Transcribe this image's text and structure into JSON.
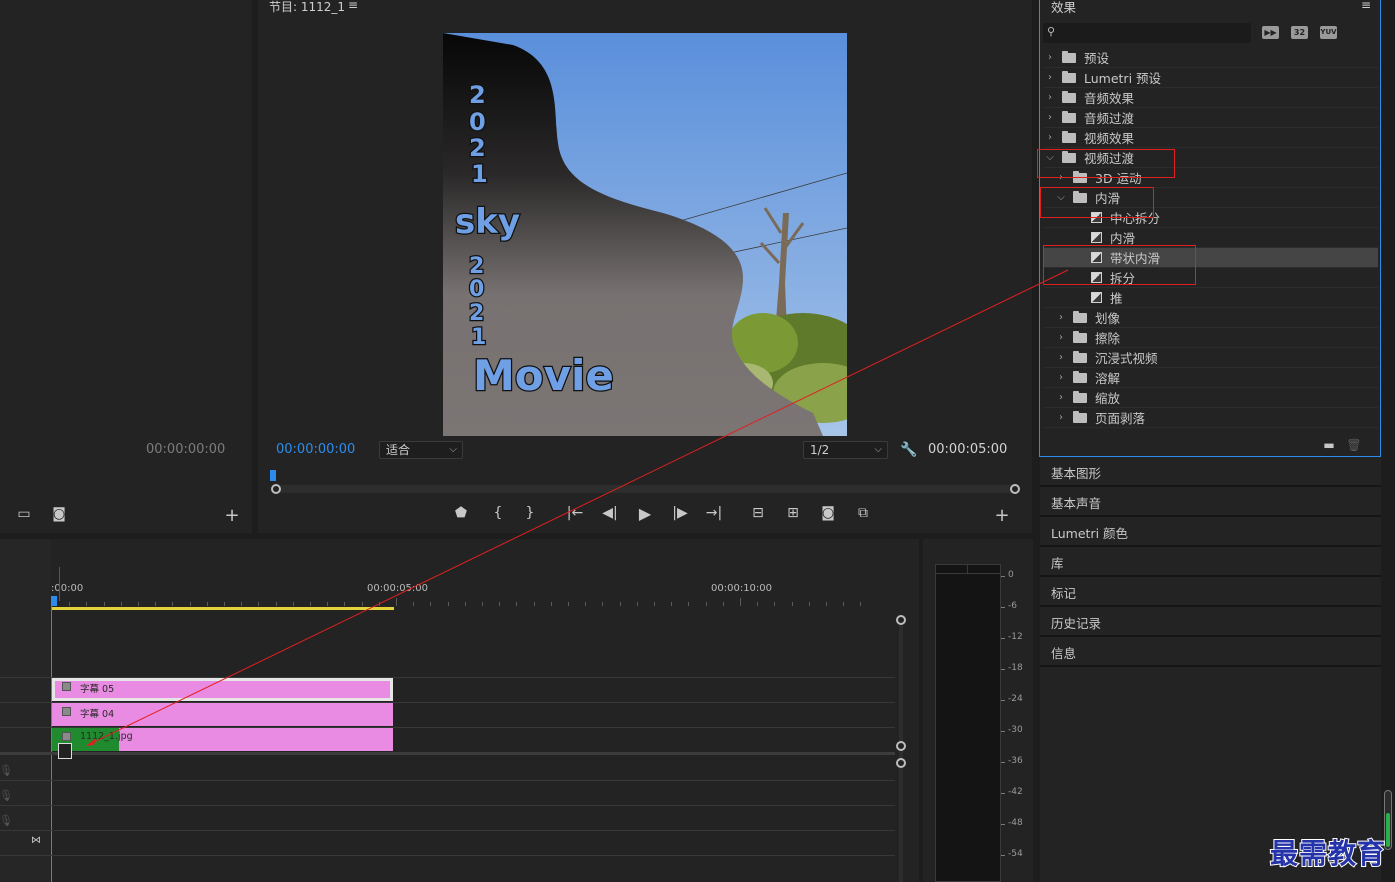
{
  "source_panel": {
    "timecode": "00:00:00:00"
  },
  "program": {
    "title": "节目: 1112_1",
    "menu_icon": "hamburger-icon",
    "timecode_current": "00:00:00:00",
    "fit_select": "适合",
    "resolution_select": "1/2",
    "timecode_duration": "00:00:05:00",
    "video_text": {
      "year1": "2021",
      "sky": "sky",
      "year2": "2021",
      "movie": "Movie"
    }
  },
  "effects": {
    "title": "效果",
    "search_placeholder": "",
    "badges": [
      "32",
      "YUV"
    ],
    "tree": [
      {
        "label": "预设",
        "level": 0,
        "expanded": false,
        "kind": "folder-star"
      },
      {
        "label": "Lumetri 预设",
        "level": 0,
        "expanded": false,
        "kind": "folder-star"
      },
      {
        "label": "音频效果",
        "level": 0,
        "expanded": false,
        "kind": "folder"
      },
      {
        "label": "音频过渡",
        "level": 0,
        "expanded": false,
        "kind": "folder"
      },
      {
        "label": "视频效果",
        "level": 0,
        "expanded": false,
        "kind": "folder"
      },
      {
        "label": "视频过渡",
        "level": 0,
        "expanded": true,
        "kind": "folder"
      },
      {
        "label": "3D 运动",
        "level": 1,
        "expanded": false,
        "kind": "folder"
      },
      {
        "label": "内滑",
        "level": 1,
        "expanded": true,
        "kind": "folder"
      },
      {
        "label": "中心拆分",
        "level": 2,
        "kind": "effect"
      },
      {
        "label": "内滑",
        "level": 2,
        "kind": "effect"
      },
      {
        "label": "带状内滑",
        "level": 2,
        "kind": "effect",
        "selected": true
      },
      {
        "label": "拆分",
        "level": 2,
        "kind": "effect"
      },
      {
        "label": "推",
        "level": 2,
        "kind": "effect"
      },
      {
        "label": "划像",
        "level": 1,
        "expanded": false,
        "kind": "folder"
      },
      {
        "label": "擦除",
        "level": 1,
        "expanded": false,
        "kind": "folder"
      },
      {
        "label": "沉浸式视频",
        "level": 1,
        "expanded": false,
        "kind": "folder"
      },
      {
        "label": "溶解",
        "level": 1,
        "expanded": false,
        "kind": "folder"
      },
      {
        "label": "缩放",
        "level": 1,
        "expanded": false,
        "kind": "folder"
      },
      {
        "label": "页面剥落",
        "level": 1,
        "expanded": false,
        "kind": "folder"
      }
    ]
  },
  "side_panels": [
    "基本图形",
    "基本声音",
    "Lumetri 颜色",
    "库",
    "标记",
    "历史记录",
    "信息"
  ],
  "timeline": {
    "ruler_labels": [
      ":00:00",
      "00:00:05:00",
      "00:00:10:00"
    ],
    "clips": [
      {
        "label": "字幕 05"
      },
      {
        "label": "字幕 04"
      },
      {
        "label": "1112_1.jpg"
      }
    ]
  },
  "audio_meter": {
    "labels": [
      "0",
      "-6",
      "-12",
      "-18",
      "-24",
      "-30",
      "-36",
      "-42",
      "-48",
      "-54"
    ]
  },
  "watermark": "最需教育",
  "colors": {
    "accent_blue": "#2d8ceb",
    "highlight_red": "#e02020",
    "clip_pink": "#e98be2",
    "clip_green": "#1f8a2e",
    "work_area_yellow": "#e3d23a"
  }
}
